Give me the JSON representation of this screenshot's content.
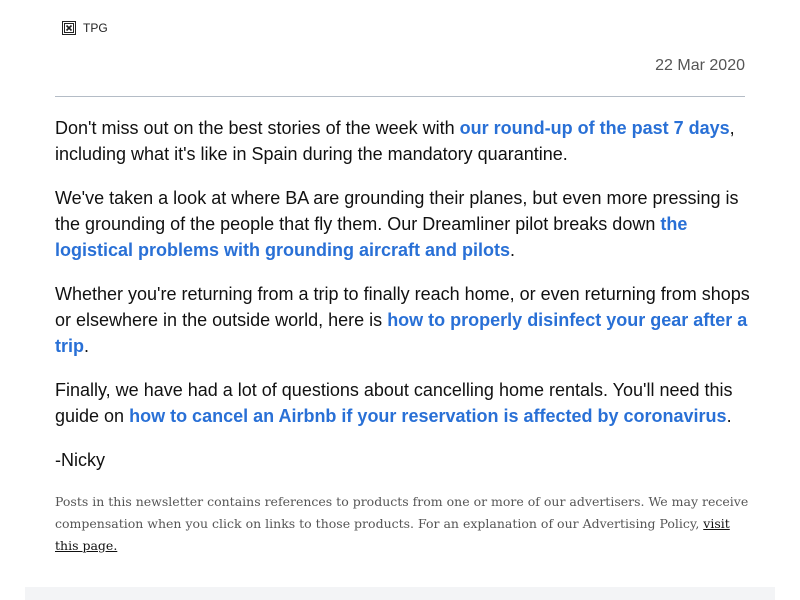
{
  "header": {
    "logo_alt": "TPG",
    "logo_icon": "broken-image-icon",
    "date": "22 Mar 2020"
  },
  "paragraphs": [
    {
      "before": "Don't miss out on the best stories of the week with ",
      "link": "our round-up of the past 7 days",
      "after": ", including what it's like in Spain during the mandatory quarantine."
    },
    {
      "before": "We've taken a look at where BA are grounding their planes, but even more pressing is the grounding of the people that fly them. Our Dreamliner pilot breaks down ",
      "link": "the logistical problems with grounding aircraft and pilots",
      "after": "."
    },
    {
      "before": "Whether you're returning from a trip to finally reach home, or even returning from shops or elsewhere in the outside world, here is ",
      "link": "how to properly disinfect your gear after a trip",
      "after": "."
    },
    {
      "before": "Finally, we have had a lot of questions about cancelling home rentals. You'll need this guide on ",
      "link": "how to cancel an Airbnb if your reservation is affected by coronavirus",
      "after": "."
    }
  ],
  "signature": "-Nicky",
  "disclaimer": {
    "text": "Posts in this newsletter contains references to products from one or more of our advertisers. We may receive compensation when you click on links to those products. For an explanation of our Advertising Policy, ",
    "link": "visit this page."
  },
  "colors": {
    "link": "#2970d6",
    "text": "#111111",
    "muted": "#555555",
    "divider": "#b4bcc6"
  }
}
